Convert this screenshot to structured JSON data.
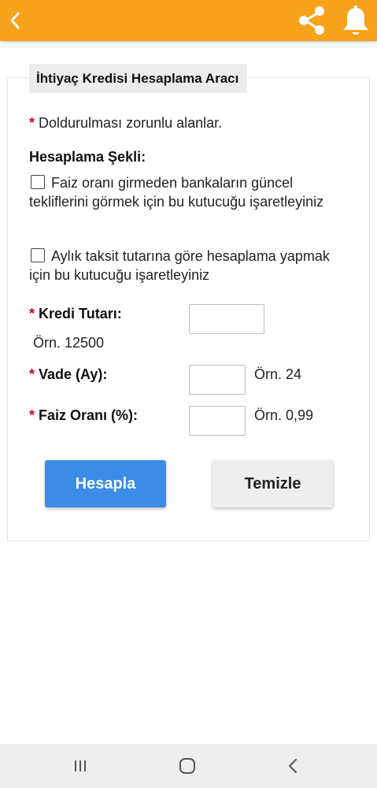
{
  "header": {
    "background_color": "#f7a21b",
    "icons": [
      "chevron-left-icon",
      "share-icon",
      "bell-icon"
    ]
  },
  "form": {
    "title": "İhtiyaç Kredisi Hesaplama Aracı",
    "required_star": "*",
    "required_note": "Doldurulması zorunlu alanlar.",
    "section_title": "Hesaplama Şekli:",
    "checkbox_1": {
      "label": "Faiz oranı girmeden bankaların güncel tekliflerini görmek için bu kutucuğu işaretleyiniz",
      "checked": false
    },
    "checkbox_2": {
      "label": "Aylık taksit tutarına göre hesaplama yapmak için bu kutucuğu işaretleyiniz",
      "checked": false
    },
    "kredi": {
      "label": "Kredi Tutarı:",
      "example": "Örn. 12500",
      "value": ""
    },
    "vade": {
      "label": "Vade (Ay):",
      "example": "Örn. 24",
      "value": ""
    },
    "faiz": {
      "label": "Faiz Oranı (%):",
      "example": "Örn. 0,99",
      "value": ""
    },
    "buttons": {
      "calculate": "Hesapla",
      "calculate_color": "#3b8ce8",
      "clear": "Temizle"
    }
  },
  "system_nav": {
    "icons": [
      "recent-apps-icon",
      "home-icon",
      "back-icon"
    ]
  }
}
